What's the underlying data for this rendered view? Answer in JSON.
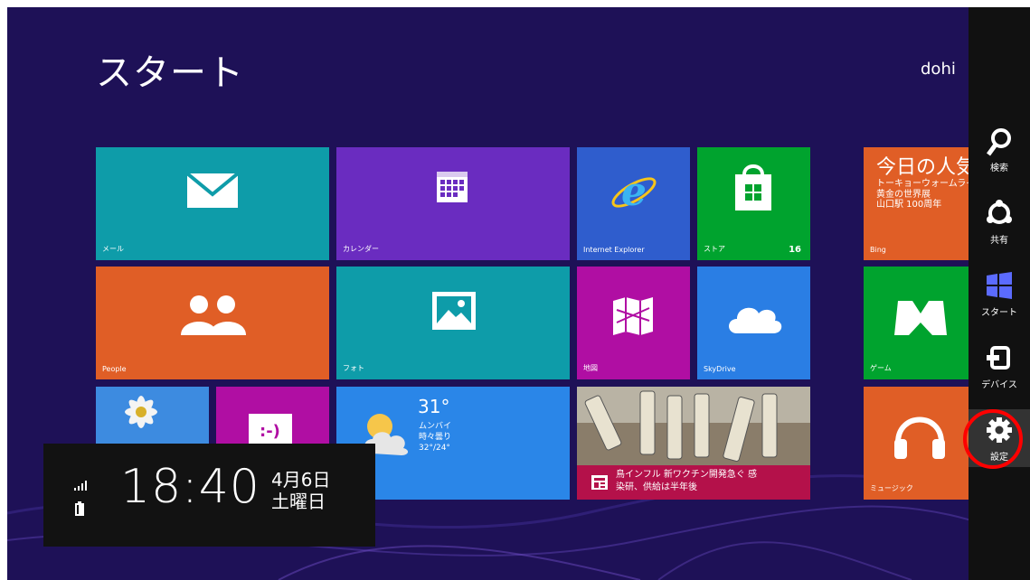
{
  "header": {
    "title": "スタート",
    "user": "dohi"
  },
  "tiles": {
    "mail": {
      "label": "メール"
    },
    "calendar": {
      "label": "カレンダー"
    },
    "ie": {
      "label": "Internet Explorer"
    },
    "store": {
      "label": "ストア",
      "badge": "16"
    },
    "bing": {
      "label": "Bing",
      "headline": "今日の人気",
      "line1": "トーキョーウォームライ",
      "line2": "黄金の世界展",
      "line3": "山口駅 100周年"
    },
    "people": {
      "label": "People"
    },
    "photos": {
      "label": "フォト"
    },
    "maps": {
      "label": "地図"
    },
    "skydrive": {
      "label": "SkyDrive"
    },
    "games": {
      "label": "ゲーム"
    },
    "weather": {
      "temp": "31°",
      "city": "ムンバイ",
      "condition": "時々曇り",
      "range": "32°/24°"
    },
    "news": {
      "line1": "鳥インフル 新ワクチン開発急ぐ 感",
      "line2": "染研、供給は半年後"
    },
    "music": {
      "label": "ミュージック"
    }
  },
  "lock_clock": {
    "time": "18:40",
    "date": "4月6日",
    "weekday": "土曜日"
  },
  "charms": {
    "search": "検索",
    "share": "共有",
    "start": "スタート",
    "devices": "デバイス",
    "settings": "設定"
  },
  "colors": {
    "background": "#1e1157",
    "teal": "#0e9ca9",
    "purple": "#6a2cc0",
    "orange": "#e05e26",
    "green": "#00a32e",
    "blue": "#2880e6",
    "magenta": "#b00ea3",
    "charm_bar": "#111111",
    "highlight": "#ff0000"
  }
}
